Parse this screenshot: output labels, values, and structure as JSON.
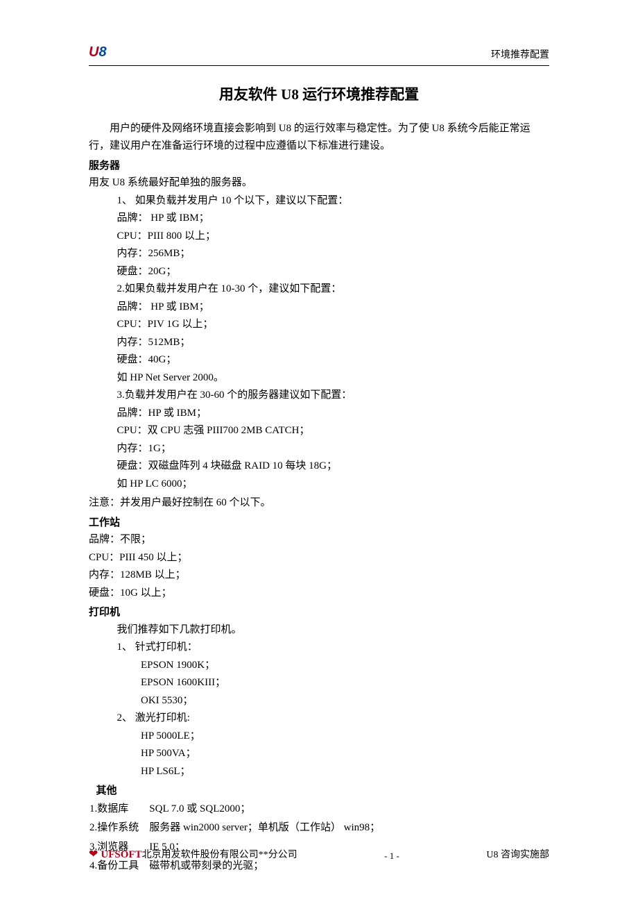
{
  "header": {
    "logo_u": "U",
    "logo_8": "8",
    "right": "环境推荐配置"
  },
  "title": "用友软件 U8 运行环境推荐配置",
  "intro": "用户的硬件及网络环境直接会影响到 U8 的运行效率与稳定性。为了使 U8 系统今后能正常运行，建议用户在准备运行环境的过程中应遵循以下标准进行建设。",
  "server": {
    "heading": "服务器",
    "line0": "用友 U8 系统最好配单独的服务器。",
    "t1_head": "1、 如果负载并发用户 10 个以下，建议以下配置：",
    "t1_brand": "品牌：  HP 或 IBM；",
    "t1_cpu": "CPU：PIII 800  以上；",
    "t1_mem": "内存：256MB；",
    "t1_disk": "硬盘：20G；",
    "t2_head": "2.如果负载并发用户在 10-30 个，建议如下配置：",
    "t2_brand": "品牌：  HP 或 IBM；",
    "t2_cpu": "CPU：PIV 1G  以上；",
    "t2_mem": "内存：512MB；",
    "t2_disk": "硬盘：40G；",
    "t2_ex": "如 HP Net Server 2000。",
    "t3_head": "3.负载并发用户在 30-60 个的服务器建议如下配置：",
    "t3_brand": "品牌：HP 或 IBM；",
    "t3_cpu": "CPU：双 CPU  志强 PIII700 2MB CATCH；",
    "t3_mem": "内存：1G；",
    "t3_disk": "硬盘：双磁盘阵列 4 块磁盘 RAID  10  每块 18G；",
    "t3_ex": "如 HP LC 6000；",
    "note": "注意：并发用户最好控制在 60 个以下。"
  },
  "ws": {
    "heading": "工作站",
    "brand": "品牌：不限；",
    "cpu": "CPU：PIII 450 以上；",
    "mem": "内存：128MB 以上；",
    "disk": "硬盘：10G 以上；"
  },
  "printer": {
    "heading": "打印机",
    "line0": "我们推荐如下几款打印机。",
    "p1_head": "1、 针式打印机：",
    "p1_a": "EPSON    1900K；",
    "p1_b": "EPSON    1600KIII；",
    "p1_c": "OKI        5530；",
    "p2_head": "2、 激光打印机:",
    "p2_a": "HP 5000LE；",
    "p2_b": "HP 500VA；",
    "p2_c": "HP LS6L；"
  },
  "other": {
    "heading": "其他",
    "rows": [
      {
        "k": "1.数据库",
        "v": "SQL 7.0 或 SQL2000；"
      },
      {
        "k": "2.操作系统",
        "v": "服务器  win2000 server；单机版（工作站）  win98；"
      },
      {
        "k": "3.浏览器",
        "v": "IE 5.0；"
      },
      {
        "k": "4.备份工具",
        "v": "磁带机或带刻录的光驱；"
      }
    ]
  },
  "footer": {
    "brand": "UFSOFT",
    "company": "北京用友软件股份有限公司**分公司",
    "page": "- 1 -",
    "dept": "U8 咨询实施部"
  }
}
